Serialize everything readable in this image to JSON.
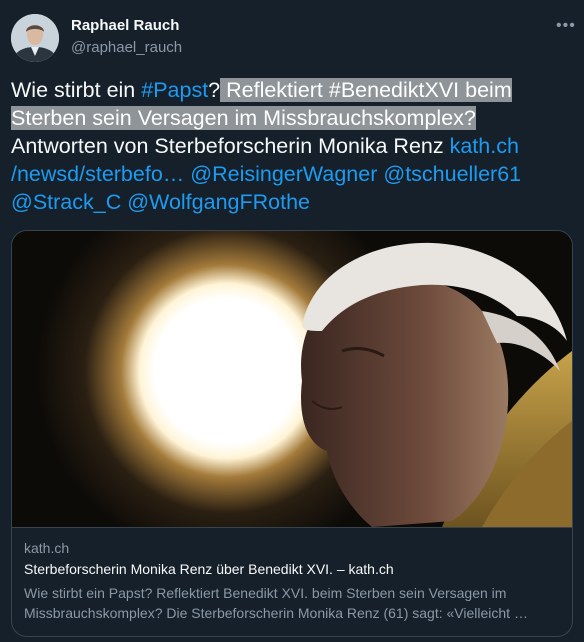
{
  "author": {
    "name": "Raphael Rauch",
    "handle": "@raphael_rauch"
  },
  "more_icon": "more-horizontal-icon",
  "tweet": {
    "w_intro": "Wie stirbt ein ",
    "w_hashtag_papst": "#Papst",
    "w_qmark": "?",
    "w_hl1": " Reflektiert #BenediktXVI beim ",
    "w_hl2": "Sterben sein Versagen im Missbrauchskomplex?",
    "w_line3": "Antworten von Sterbeforscherin Monika Renz ",
    "w_link_a": "kath.ch",
    "w_link_b": "/newsd/sterbefo…",
    "w_mention1": " @ReisingerWagner",
    "w_mention2": " @tschueller61",
    "w_mention3": "@Strack_C",
    "w_mention4": " @WolfgangFRothe"
  },
  "card": {
    "domain": "kath.ch",
    "title": "Sterbeforscherin Monika Renz über Benedikt XVI. – kath.ch",
    "description": "Wie stirbt ein Papst? Reflektiert Benedikt XVI. beim Sterben sein Versagen im Missbrauchskomplex? Die Sterbeforscherin Monika Renz (61) sagt: «Vielleicht …"
  },
  "colors": {
    "background": "#15202b",
    "link": "#1d9bf0",
    "secondary_text": "#8b98a5",
    "highlight": "#8e9497",
    "border": "#38444d"
  }
}
